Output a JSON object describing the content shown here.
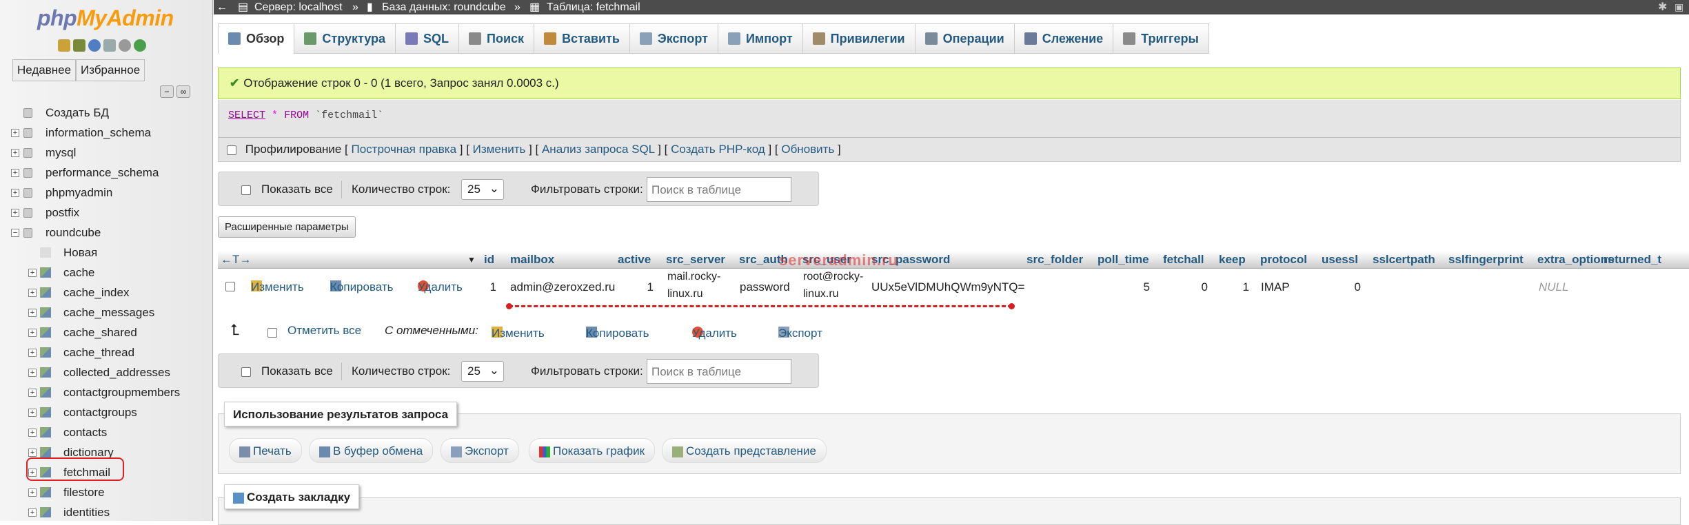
{
  "logo": {
    "php": "php",
    "myadmin": "MyAdmin"
  },
  "nav": {
    "recent_label": "Недавнее",
    "favorites_label": "Избранное",
    "tree": [
      {
        "label": "Создать БД",
        "kind": "new"
      },
      {
        "label": "information_schema",
        "kind": "db"
      },
      {
        "label": "mysql",
        "kind": "db"
      },
      {
        "label": "performance_schema",
        "kind": "db"
      },
      {
        "label": "phpmyadmin",
        "kind": "db"
      },
      {
        "label": "postfix",
        "kind": "db"
      },
      {
        "label": "roundcube",
        "kind": "db-open"
      },
      {
        "label": "Новая",
        "kind": "new-table"
      },
      {
        "label": "cache",
        "kind": "table"
      },
      {
        "label": "cache_index",
        "kind": "table"
      },
      {
        "label": "cache_messages",
        "kind": "table"
      },
      {
        "label": "cache_shared",
        "kind": "table"
      },
      {
        "label": "cache_thread",
        "kind": "table"
      },
      {
        "label": "collected_addresses",
        "kind": "table"
      },
      {
        "label": "contactgroupmembers",
        "kind": "table"
      },
      {
        "label": "contactgroups",
        "kind": "table"
      },
      {
        "label": "contacts",
        "kind": "table"
      },
      {
        "label": "dictionary",
        "kind": "table"
      },
      {
        "label": "fetchmail",
        "kind": "table-selected"
      },
      {
        "label": "filestore",
        "kind": "table"
      },
      {
        "label": "identities",
        "kind": "table"
      }
    ]
  },
  "breadcrumb": {
    "server": "Сервер: localhost",
    "database": "База данных: roundcube",
    "table": "Таблица: fetchmail",
    "sep": "»"
  },
  "tabs": [
    {
      "label": "Обзор",
      "active": true,
      "icon": "browse-icon"
    },
    {
      "label": "Структура",
      "icon": "structure-icon"
    },
    {
      "label": "SQL",
      "icon": "sql-icon"
    },
    {
      "label": "Поиск",
      "icon": "search-icon"
    },
    {
      "label": "Вставить",
      "icon": "insert-icon"
    },
    {
      "label": "Экспорт",
      "icon": "export-icon"
    },
    {
      "label": "Импорт",
      "icon": "import-icon"
    },
    {
      "label": "Привилегии",
      "icon": "privileges-icon"
    },
    {
      "label": "Операции",
      "icon": "operations-icon"
    },
    {
      "label": "Слежение",
      "icon": "tracking-icon"
    },
    {
      "label": "Триггеры",
      "icon": "triggers-icon"
    }
  ],
  "success_message": "Отображение строк 0 - 0 (1 всего, Запрос занял 0.0003 с.)",
  "sql": {
    "select": "SELECT",
    "star": "*",
    "from": "FROM",
    "table": "`fetchmail`"
  },
  "profiling": {
    "label": "Профилирование",
    "links": [
      "Построчная правка",
      "Изменить",
      "Анализ запроса SQL",
      "Создать PHP-код",
      "Обновить"
    ]
  },
  "navbar": {
    "show_all": "Показать все",
    "rows_label": "Количество строк:",
    "rows_value": "25",
    "filter_label": "Фильтровать строки:",
    "filter_placeholder": "Поиск в таблице"
  },
  "extended_options": "Расширенные параметры",
  "columns": [
    "id",
    "mailbox",
    "active",
    "src_server",
    "src_auth",
    "src_user",
    "src_password",
    "src_folder",
    "poll_time",
    "fetchall",
    "keep",
    "protocol",
    "usessl",
    "sslcertpath",
    "sslfingerprint",
    "extra_options",
    "returned_t"
  ],
  "row": {
    "edit": "Изменить",
    "copy": "Копировать",
    "delete": "Удалить",
    "id": "1",
    "mailbox": "admin@zeroxzed.ru",
    "active": "1",
    "src_server_1": "mail.rocky-",
    "src_server_2": "linux.ru",
    "src_auth": "password",
    "src_user_1": "root@rocky-",
    "src_user_2": "linux.ru",
    "src_password": "UUx5eVlDMUhQWm9yNTQ=",
    "poll_time": "5",
    "fetchall": "0",
    "keep": "1",
    "protocol": "IMAP",
    "usessl": "0",
    "extra_options": "NULL"
  },
  "watermark": "serveradmin.ru",
  "with_selected": {
    "check_all": "Отметить все",
    "label": "С отмеченными:",
    "edit": "Изменить",
    "copy": "Копировать",
    "delete": "Удалить",
    "export": "Экспорт"
  },
  "query_results": {
    "legend": "Использование результатов запроса",
    "print": "Печать",
    "clipboard": "В буфер обмена",
    "export": "Экспорт",
    "chart": "Показать график",
    "view": "Создать представление"
  },
  "bookmark": {
    "legend": "Создать закладку"
  },
  "colors": {
    "link": "#235a81",
    "success_bg": "#ebf8a4",
    "topbar": "#4c4c4c",
    "highlight": "#e02020"
  }
}
